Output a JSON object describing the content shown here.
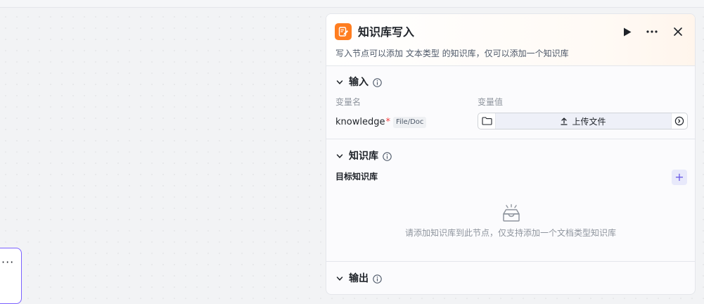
{
  "panel": {
    "title": "知识库写入",
    "description": "写入节点可以添加 文本类型 的知识库，仅可以添加一个知识库"
  },
  "input_section": {
    "title": "输入",
    "col_name_label": "变量名",
    "col_value_label": "变量值",
    "variable": {
      "name": "knowledge",
      "required_mark": "*",
      "type_tag": "File/Doc"
    },
    "upload_label": "上传文件"
  },
  "knowledge_section": {
    "title": "知识库",
    "target_label": "目标知识库",
    "add_label": "+",
    "empty_text": "请添加知识库到此节点，仅支持添加一个文档类型知识库"
  },
  "output_section": {
    "title": "输出"
  },
  "colors": {
    "accent": "#7b61ff",
    "node_icon": "#ff7d20",
    "required": "#f53f3f"
  },
  "icons": [
    "node-write-icon",
    "play-icon",
    "more-icon",
    "close-icon",
    "chevron-down-icon",
    "info-icon",
    "folder-icon",
    "upload-icon",
    "variable-ref-icon",
    "empty-inbox-icon"
  ]
}
